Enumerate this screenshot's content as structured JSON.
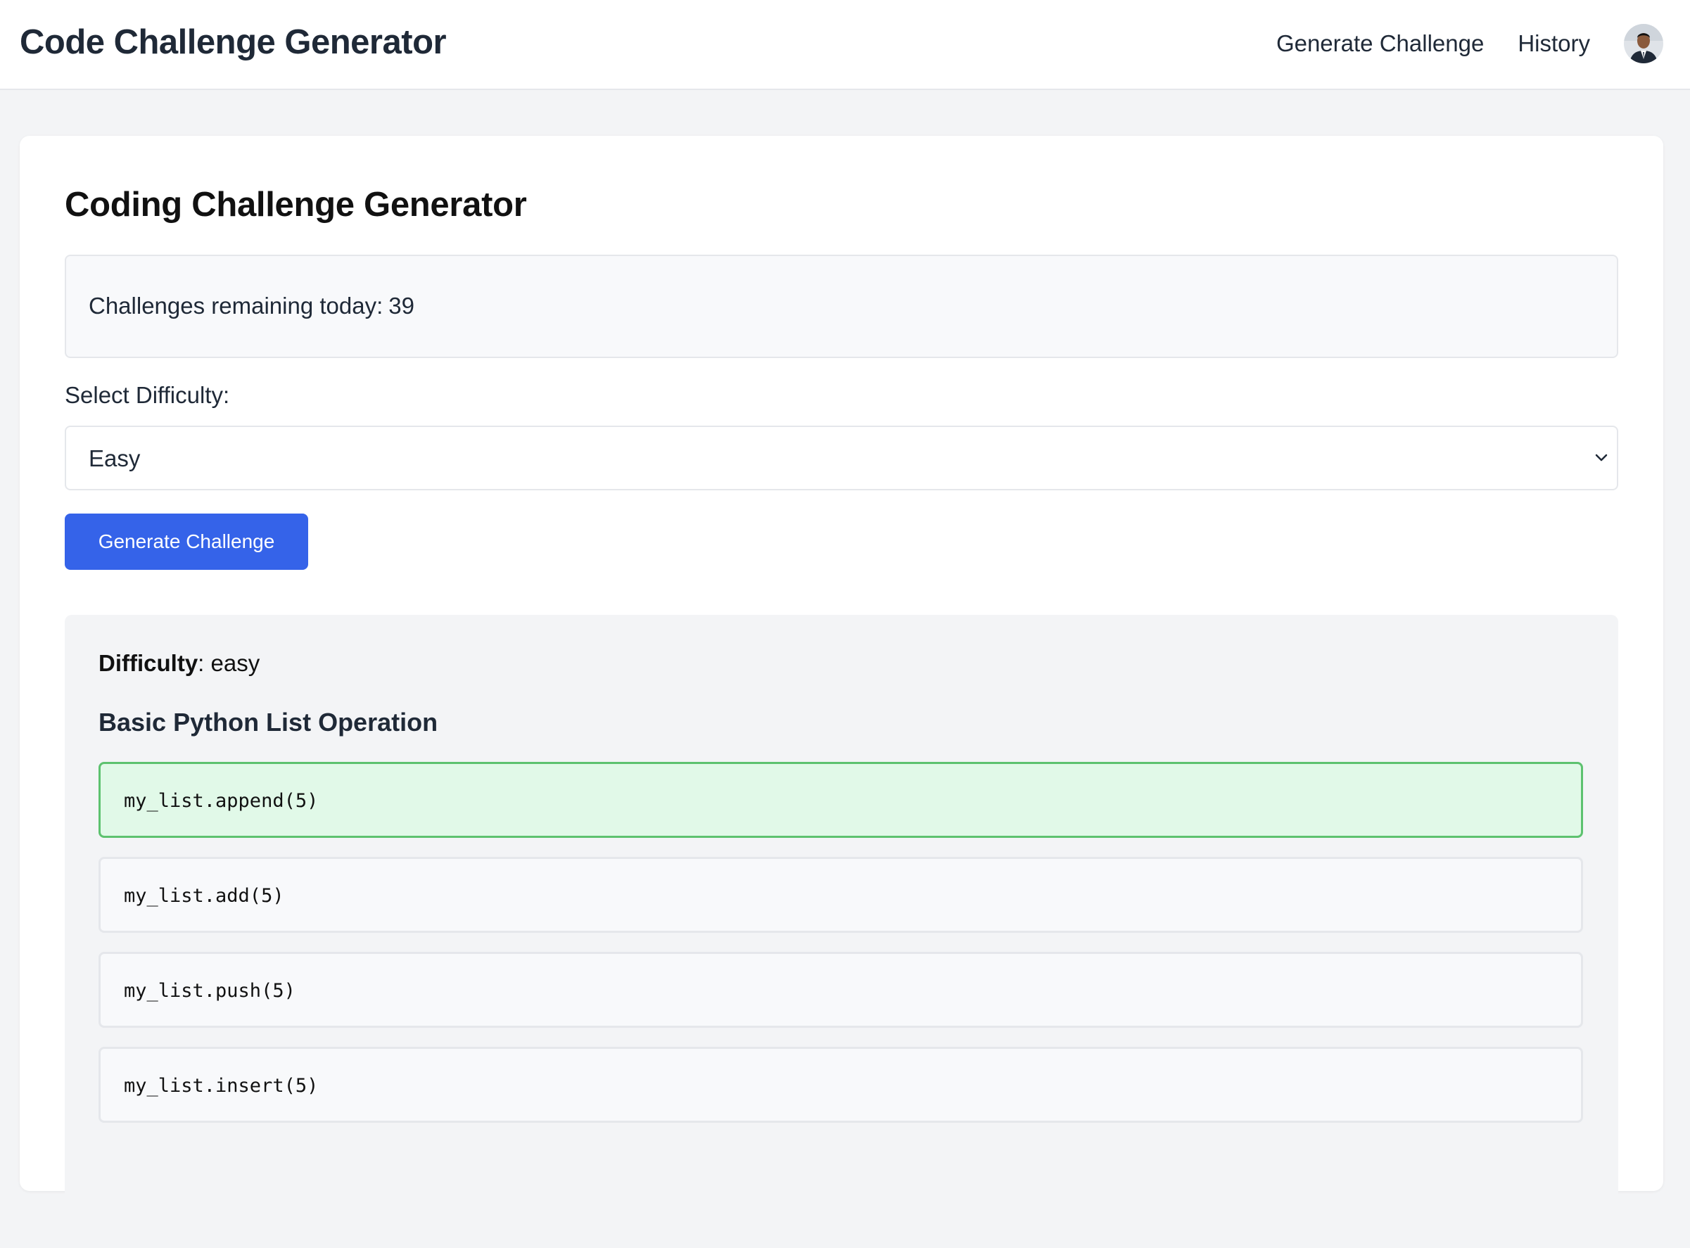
{
  "header": {
    "app_title": "Code Challenge Generator",
    "nav": [
      {
        "label": "Generate Challenge"
      },
      {
        "label": "History"
      }
    ]
  },
  "main": {
    "title": "Coding Challenge Generator",
    "quota": {
      "label": "Challenges remaining today:",
      "count": "39"
    },
    "difficulty_select": {
      "label": "Select Difficulty:",
      "value": "Easy",
      "icon": "chevron-down-icon"
    },
    "generate_button": {
      "label": "Generate Challenge"
    },
    "challenge": {
      "difficulty_label": "Difficulty",
      "difficulty_value": ": easy",
      "title": "Basic Python List Operation",
      "options": [
        {
          "code": "my_list.append(5)",
          "state": "correct"
        },
        {
          "code": "my_list.add(5)",
          "state": "default"
        },
        {
          "code": "my_list.push(5)",
          "state": "default"
        },
        {
          "code": "my_list.insert(5)",
          "state": "default"
        }
      ]
    }
  },
  "colors": {
    "primary": "#3563e9",
    "correct_bg": "#e1f9e8",
    "correct_border": "#5dc26f",
    "page_bg": "#f3f4f6"
  }
}
